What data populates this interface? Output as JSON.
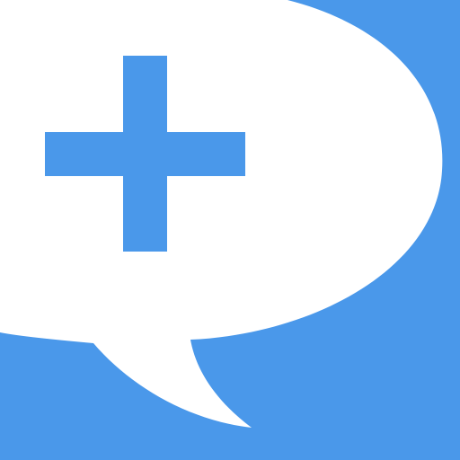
{
  "icon": {
    "name": "add-comment-icon",
    "colors": {
      "background": "#4a98ea",
      "bubble": "#ffffff",
      "plus": "#4a98ea"
    }
  }
}
